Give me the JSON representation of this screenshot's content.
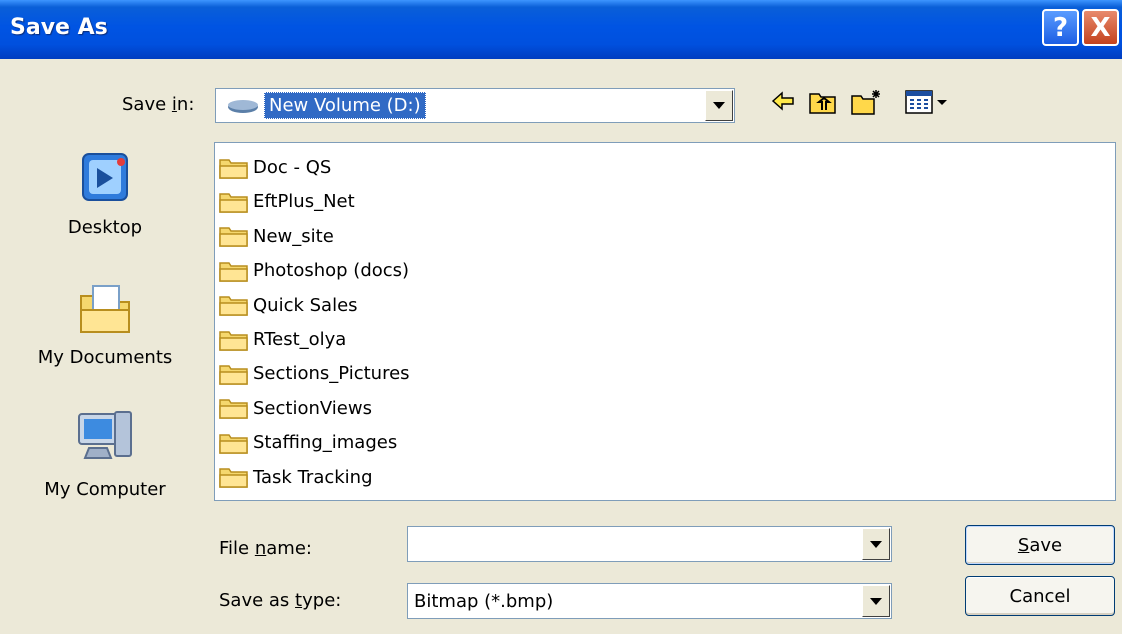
{
  "window": {
    "title": "Save As"
  },
  "save_in": {
    "label_pre": "Save ",
    "label_key": "i",
    "label_post": "n:",
    "value": "New Volume (D:)"
  },
  "places": [
    {
      "label": "Desktop"
    },
    {
      "label": "My Documents"
    },
    {
      "label": "My Computer"
    }
  ],
  "files": [
    "Doc - QS",
    "EftPlus_Net",
    "New_site",
    "Photoshop (docs)",
    "Quick Sales",
    "RTest_olya",
    "Sections_Pictures",
    "SectionViews",
    "Staffing_images",
    "Task Tracking"
  ],
  "file_name": {
    "label_pre": "File ",
    "label_key": "n",
    "label_post": "ame:",
    "value": ""
  },
  "save_type": {
    "label_pre": "Save as ",
    "label_key": "t",
    "label_post": "ype:",
    "value": "Bitmap (*.bmp)"
  },
  "buttons": {
    "save_key": "S",
    "save_rest": "ave",
    "cancel": "Cancel",
    "help": "?",
    "close": "X"
  },
  "colors": {
    "title_bar": "#0054e3",
    "folder": "#f5d76e",
    "selection": "#316ac5"
  }
}
